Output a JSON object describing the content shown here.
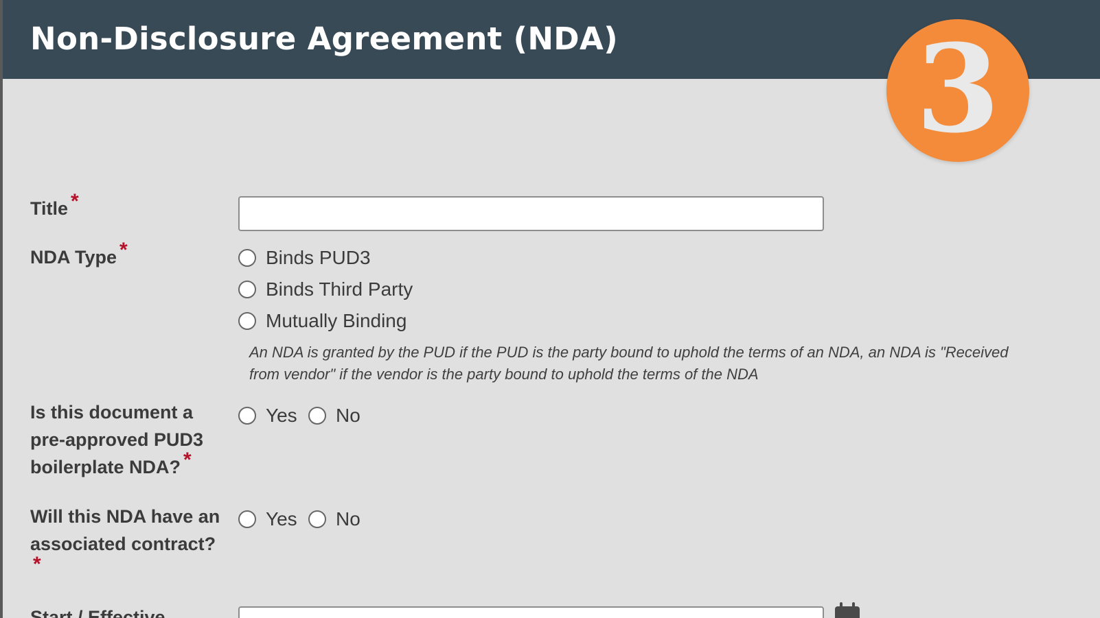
{
  "header": {
    "title": "Non-Disclosure Agreement (NDA)",
    "logo_text": "3"
  },
  "colors": {
    "header_bg": "#384a56",
    "logo_orange": "#f38b3a",
    "required_red": "#b5122a",
    "page_bg": "#e0e0e0"
  },
  "form": {
    "title_field": {
      "label": "Title",
      "required": "*",
      "value": ""
    },
    "nda_type": {
      "label": "NDA Type",
      "required": "*",
      "options": [
        "Binds PUD3",
        "Binds Third Party",
        "Mutually Binding"
      ],
      "help_text": "An NDA is granted by the PUD if the PUD is the party bound to uphold the terms of an NDA, an NDA is \"Received from vendor\" if the vendor is the party bound to uphold the terms of the NDA"
    },
    "preapproved": {
      "label_line1": "Is this document a",
      "label_line2": "pre-approved PUD3",
      "label_line3": "boilerplate NDA?",
      "required": "*",
      "yes": "Yes",
      "no": "No"
    },
    "associated_contract": {
      "label_line1": "Will this NDA have an",
      "label_line2": "associated contract?",
      "required": "*",
      "yes": "Yes",
      "no": "No"
    },
    "start_date": {
      "label": "Start / Effective",
      "value": "",
      "icon": "calendar-icon"
    }
  }
}
